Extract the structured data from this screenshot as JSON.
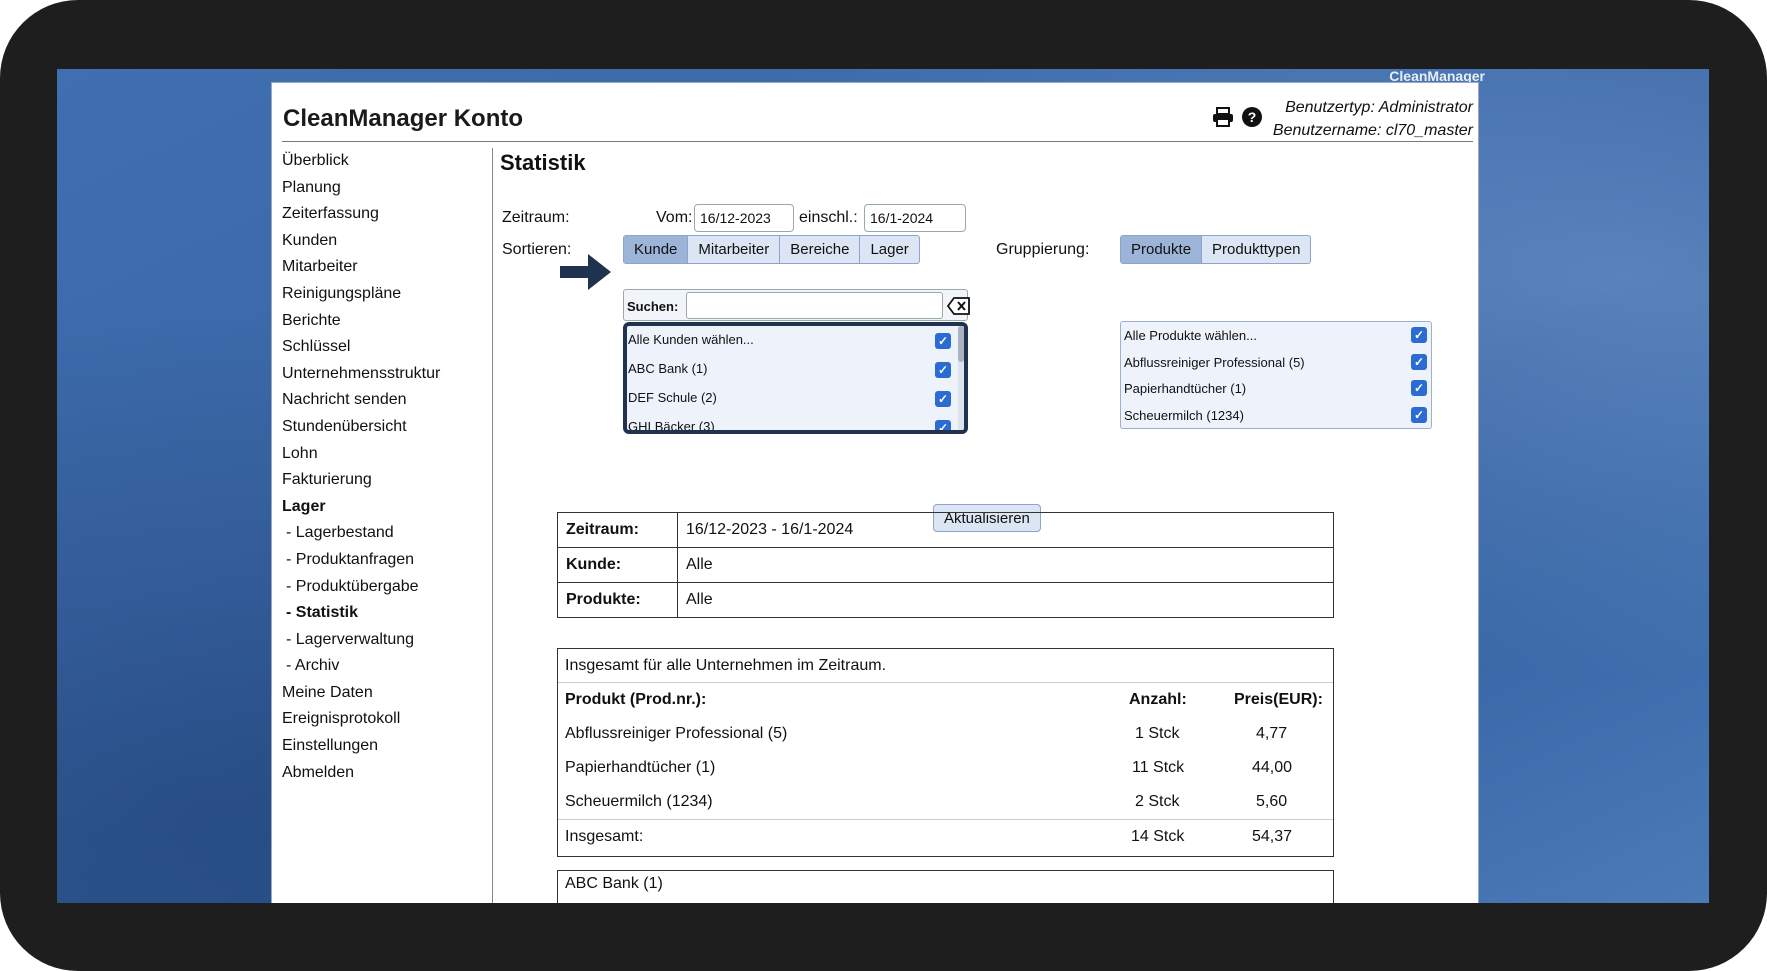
{
  "brand": "CleanManager",
  "header": {
    "title": "CleanManager Konto",
    "user_type": "Benutzertyp: Administrator",
    "user_name": "Benutzername: cl70_master",
    "icons": [
      "print-icon",
      "help-icon"
    ]
  },
  "sidebar": {
    "items": [
      {
        "label": "Überblick"
      },
      {
        "label": "Planung"
      },
      {
        "label": "Zeiterfassung"
      },
      {
        "label": "Kunden"
      },
      {
        "label": "Mitarbeiter"
      },
      {
        "label": "Reinigungspläne"
      },
      {
        "label": "Berichte"
      },
      {
        "label": "Schlüssel"
      },
      {
        "label": "Unternehmensstruktur"
      },
      {
        "label": "Nachricht senden"
      },
      {
        "label": "Stundenübersicht"
      },
      {
        "label": "Lohn"
      },
      {
        "label": "Fakturierung"
      },
      {
        "label": "Lager"
      },
      {
        "label": "- Lagerbestand"
      },
      {
        "label": "- Produktanfragen"
      },
      {
        "label": "- Produktübergabe"
      },
      {
        "label": "- Statistik"
      },
      {
        "label": "- Lagerverwaltung"
      },
      {
        "label": "- Archiv"
      },
      {
        "label": "Meine Daten"
      },
      {
        "label": "Ereignisprotokoll"
      },
      {
        "label": "Einstellungen"
      },
      {
        "label": "Abmelden"
      }
    ]
  },
  "main": {
    "title": "Statistik",
    "zeitraum_label": "Zeitraum:",
    "vom_label": "Vom:",
    "vom_value": "16/12-2023",
    "einschl_label": "einschl.:",
    "einschl_value": "16/1-2024",
    "sortieren_label": "Sortieren:",
    "sort_tabs": [
      "Kunde",
      "Mitarbeiter",
      "Bereiche",
      "Lager"
    ],
    "gruppierung_label": "Gruppierung:",
    "group_tabs": [
      "Produkte",
      "Produkttypen"
    ],
    "search_label": "Suchen:",
    "search_value": "",
    "customer_list": [
      "Alle Kunden wählen...",
      "ABC Bank (1)",
      "DEF Schule (2)",
      "GHI Bäcker (3)"
    ],
    "product_list": [
      "Alle Produkte wählen...",
      "Abflussreiniger Professional (5)",
      "Papierhandtücher (1)",
      "Scheuermilch (1234)"
    ],
    "update_button": "Aktualisieren"
  },
  "summary": {
    "rows": [
      {
        "key": "Zeitraum:",
        "value": "16/12-2023 - 16/1-2024"
      },
      {
        "key": "Kunde:",
        "value": "Alle"
      },
      {
        "key": "Produkte:",
        "value": "Alle"
      }
    ]
  },
  "totals": {
    "heading": "Insgesamt für alle Unternehmen im Zeitraum.",
    "col_product": "Produkt (Prod.nr.):",
    "col_count": "Anzahl:",
    "col_price": "Preis(EUR):",
    "rows": [
      {
        "product": "Abflussreiniger Professional (5)",
        "count": "1 Stck",
        "price": "4,77"
      },
      {
        "product": "Papierhandtücher (1)",
        "count": "11 Stck",
        "price": "44,00"
      },
      {
        "product": "Scheuermilch (1234)",
        "count": "2 Stck",
        "price": "5,60"
      }
    ],
    "total_label": "Insgesamt:",
    "total_count": "14 Stck",
    "total_price": "54,37"
  },
  "next_box": {
    "heading": "ABC Bank (1)"
  }
}
